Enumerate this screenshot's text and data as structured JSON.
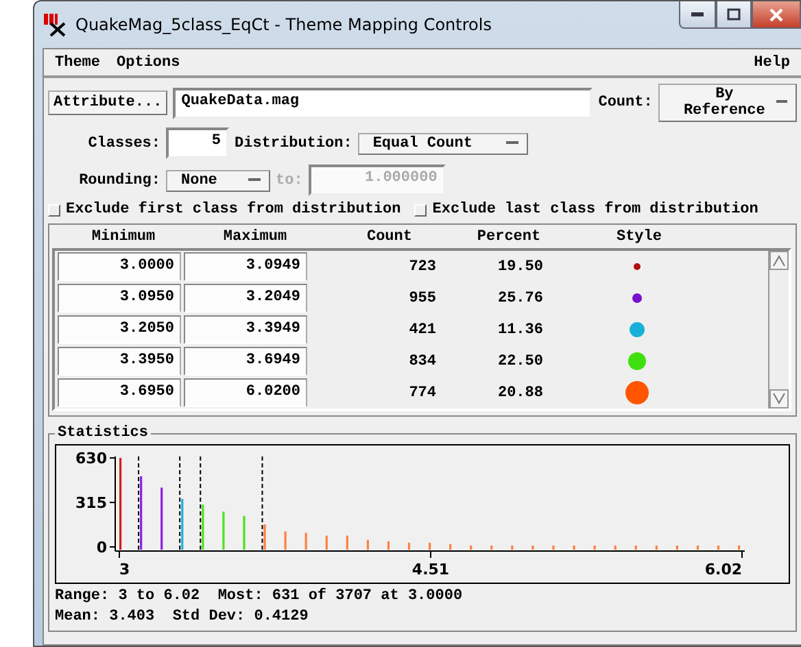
{
  "window": {
    "title": "QuakeMag_5class_EqCt - Theme Mapping Controls"
  },
  "menu": [
    {
      "label": "Theme"
    },
    {
      "label": "Options"
    },
    {
      "label": "Help"
    }
  ],
  "attribute": {
    "button": "Attribute...",
    "value": "QuakeData.mag"
  },
  "count": {
    "label": "Count:",
    "value": "By Reference"
  },
  "classes": {
    "label": "Classes:",
    "value": "5"
  },
  "distribution": {
    "label": "Distribution:",
    "value": "Equal Count"
  },
  "rounding": {
    "label": "Rounding:",
    "value": "None",
    "to_label": "to:",
    "to_value": "1.000000",
    "to_disabled": true
  },
  "options": [
    {
      "label": "Exclude first class from distribution",
      "checked": false
    },
    {
      "label": "Exclude last class from distribution",
      "checked": false
    }
  ],
  "table": {
    "columns": [
      "Minimum",
      "Maximum",
      "Count",
      "Percent",
      "Style"
    ],
    "rows": [
      {
        "minimum": "3.0000",
        "maximum": "3.0949",
        "count": "723",
        "percent": "19.50",
        "color": "#b01010",
        "kind": "tiny"
      },
      {
        "minimum": "3.0950",
        "maximum": "3.2049",
        "count": "955",
        "percent": "25.76",
        "color": "#7a10d0",
        "kind": "small"
      },
      {
        "minimum": "3.2050",
        "maximum": "3.3949",
        "count": "421",
        "percent": "11.36",
        "color": "#18b0d8",
        "kind": "medium"
      },
      {
        "minimum": "3.3950",
        "maximum": "3.6949",
        "count": "834",
        "percent": "22.50",
        "color": "#40e010",
        "kind": "large"
      },
      {
        "minimum": "3.6950",
        "maximum": "6.0200",
        "count": "774",
        "percent": "20.88",
        "color": "#ff5500",
        "kind": "xlarge"
      }
    ]
  },
  "statistics": {
    "title": "Statistics",
    "chart_data": {
      "type": "bar",
      "x": [
        3.0,
        3.1,
        3.2,
        3.3,
        3.4,
        3.5,
        3.6,
        3.7,
        3.8,
        3.9,
        4.0,
        4.1,
        4.2,
        4.3,
        4.4,
        4.5,
        4.6,
        4.7,
        4.8,
        4.9,
        5.0,
        5.1,
        5.2,
        5.3,
        5.4,
        5.5,
        5.6,
        5.7,
        5.8,
        5.9,
        6.0
      ],
      "series": [
        {
          "color": "#d02020",
          "values": [
            630,
            null,
            null,
            null,
            null,
            null,
            null,
            null,
            null,
            null,
            null,
            null,
            null,
            null,
            null,
            null,
            null,
            null,
            null,
            null,
            null,
            null,
            null,
            null,
            null,
            null,
            null,
            null,
            null,
            null,
            null
          ]
        },
        {
          "color": "#8a20e0",
          "values": [
            null,
            500,
            420,
            null,
            null,
            null,
            null,
            null,
            null,
            null,
            null,
            null,
            null,
            null,
            null,
            null,
            null,
            null,
            null,
            null,
            null,
            null,
            null,
            null,
            null,
            null,
            null,
            null,
            null,
            null,
            null
          ]
        },
        {
          "color": "#20b0e0",
          "values": [
            null,
            null,
            null,
            340,
            null,
            null,
            null,
            null,
            null,
            null,
            null,
            null,
            null,
            null,
            null,
            null,
            null,
            null,
            null,
            null,
            null,
            null,
            null,
            null,
            null,
            null,
            null,
            null,
            null,
            null,
            null
          ]
        },
        {
          "color": "#50e020",
          "values": [
            null,
            null,
            null,
            null,
            300,
            250,
            220,
            null,
            null,
            null,
            null,
            null,
            null,
            null,
            null,
            null,
            null,
            null,
            null,
            null,
            null,
            null,
            null,
            null,
            null,
            null,
            null,
            null,
            null,
            null,
            null
          ]
        },
        {
          "color": "#ff8040",
          "values": [
            null,
            null,
            null,
            null,
            null,
            null,
            null,
            160,
            110,
            100,
            80,
            80,
            50,
            40,
            30,
            30,
            20,
            10,
            10,
            10,
            10,
            10,
            10,
            10,
            10,
            10,
            10,
            10,
            10,
            10,
            10
          ]
        }
      ],
      "xlim": [
        3,
        6.02
      ],
      "ylim": [
        0,
        660
      ],
      "xticks": [
        3,
        4.51,
        6.02
      ],
      "yticks": [
        0,
        315,
        630
      ]
    },
    "lines": [
      "Range: 3 to 6.02  Most: 631 of 3707 at 3.0000",
      "Mean: 3.403  Std Dev: 0.4129"
    ]
  }
}
